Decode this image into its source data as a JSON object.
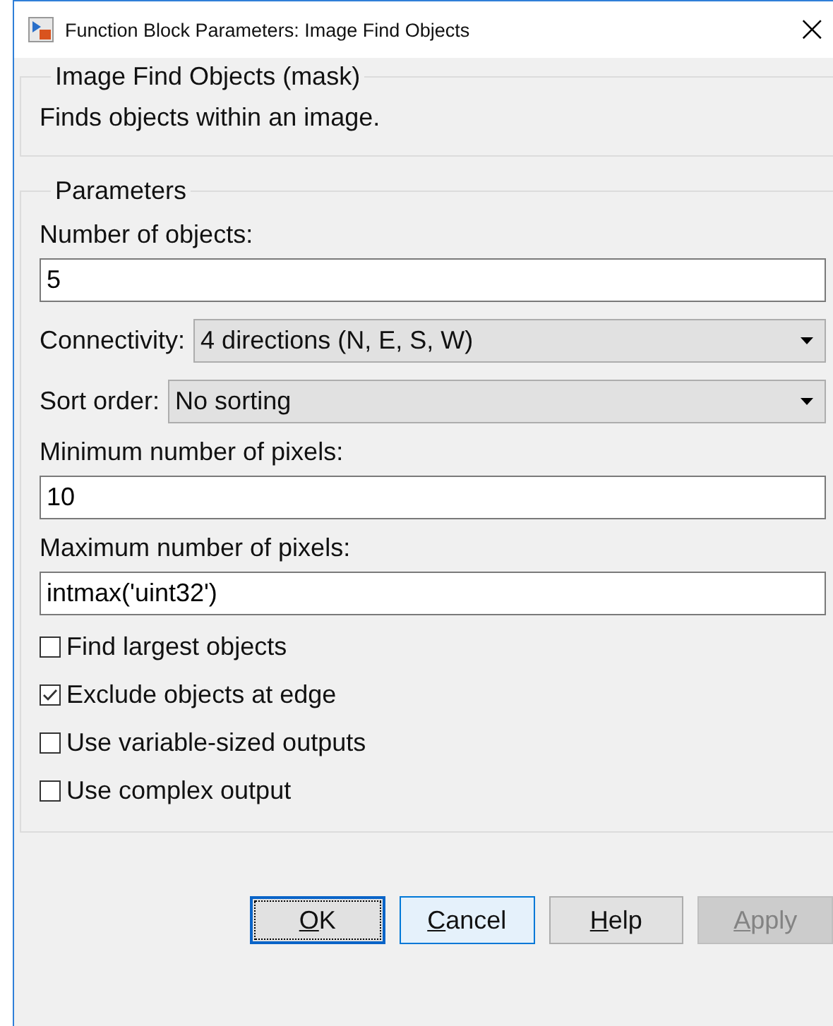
{
  "window": {
    "title": "Function Block Parameters: Image Find Objects",
    "close": "×"
  },
  "description_group": {
    "title": "Image Find Objects (mask)",
    "text": "Finds objects within an image."
  },
  "parameters": {
    "title": "Parameters",
    "fields": [
      {
        "kind": "text",
        "label": "Number of objects:",
        "value": "5"
      },
      {
        "kind": "select",
        "label": "Connectivity:",
        "value": "4 directions (N, E, S, W)"
      },
      {
        "kind": "select",
        "label": "Sort order:",
        "value": "No sorting"
      },
      {
        "kind": "text",
        "label": "Minimum number of pixels:",
        "value": "10"
      },
      {
        "kind": "text",
        "label": "Maximum number of pixels:",
        "value": "intmax('uint32')"
      }
    ],
    "checkboxes": [
      {
        "label": "Find largest objects",
        "checked": false
      },
      {
        "label": "Exclude objects at edge",
        "checked": true
      },
      {
        "label": "Use variable-sized outputs",
        "checked": false
      },
      {
        "label": "Use complex output",
        "checked": false
      }
    ]
  },
  "buttons": [
    {
      "accel": "O",
      "rest": "K",
      "kind": "default",
      "disabled": false
    },
    {
      "accel": "C",
      "rest": "ancel",
      "kind": "focused",
      "disabled": false
    },
    {
      "accel": "H",
      "rest": "elp",
      "kind": "normal",
      "disabled": false
    },
    {
      "accel": "A",
      "rest": "pply",
      "kind": "normal",
      "disabled": true
    }
  ]
}
